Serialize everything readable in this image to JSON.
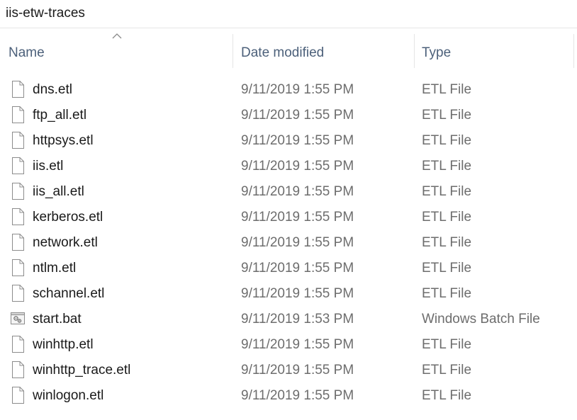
{
  "window": {
    "title": "iis-etw-traces"
  },
  "columns": {
    "name": "Name",
    "date_modified": "Date modified",
    "type": "Type"
  },
  "files": [
    {
      "name": "dns.etl",
      "date": "9/11/2019 1:55 PM",
      "type": "ETL File",
      "icon": "file-icon"
    },
    {
      "name": "ftp_all.etl",
      "date": "9/11/2019 1:55 PM",
      "type": "ETL File",
      "icon": "file-icon"
    },
    {
      "name": "httpsys.etl",
      "date": "9/11/2019 1:55 PM",
      "type": "ETL File",
      "icon": "file-icon"
    },
    {
      "name": "iis.etl",
      "date": "9/11/2019 1:55 PM",
      "type": "ETL File",
      "icon": "file-icon"
    },
    {
      "name": "iis_all.etl",
      "date": "9/11/2019 1:55 PM",
      "type": "ETL File",
      "icon": "file-icon"
    },
    {
      "name": "kerberos.etl",
      "date": "9/11/2019 1:55 PM",
      "type": "ETL File",
      "icon": "file-icon"
    },
    {
      "name": "network.etl",
      "date": "9/11/2019 1:55 PM",
      "type": "ETL File",
      "icon": "file-icon"
    },
    {
      "name": "ntlm.etl",
      "date": "9/11/2019 1:55 PM",
      "type": "ETL File",
      "icon": "file-icon"
    },
    {
      "name": "schannel.etl",
      "date": "9/11/2019 1:55 PM",
      "type": "ETL File",
      "icon": "file-icon"
    },
    {
      "name": "start.bat",
      "date": "9/11/2019 1:53 PM",
      "type": "Windows Batch File",
      "icon": "batch-file-icon"
    },
    {
      "name": "winhttp.etl",
      "date": "9/11/2019 1:55 PM",
      "type": "ETL File",
      "icon": "file-icon"
    },
    {
      "name": "winhttp_trace.etl",
      "date": "9/11/2019 1:55 PM",
      "type": "ETL File",
      "icon": "file-icon"
    },
    {
      "name": "winlogon.etl",
      "date": "9/11/2019 1:55 PM",
      "type": "ETL File",
      "icon": "file-icon"
    }
  ],
  "sort": {
    "column": "name",
    "icon": "sort-ascending-icon"
  },
  "colors": {
    "header_text": "#4c607a",
    "secondary_text": "#6d6d6d",
    "primary_text": "#1a1a1a",
    "separator": "#e5e5e5"
  }
}
